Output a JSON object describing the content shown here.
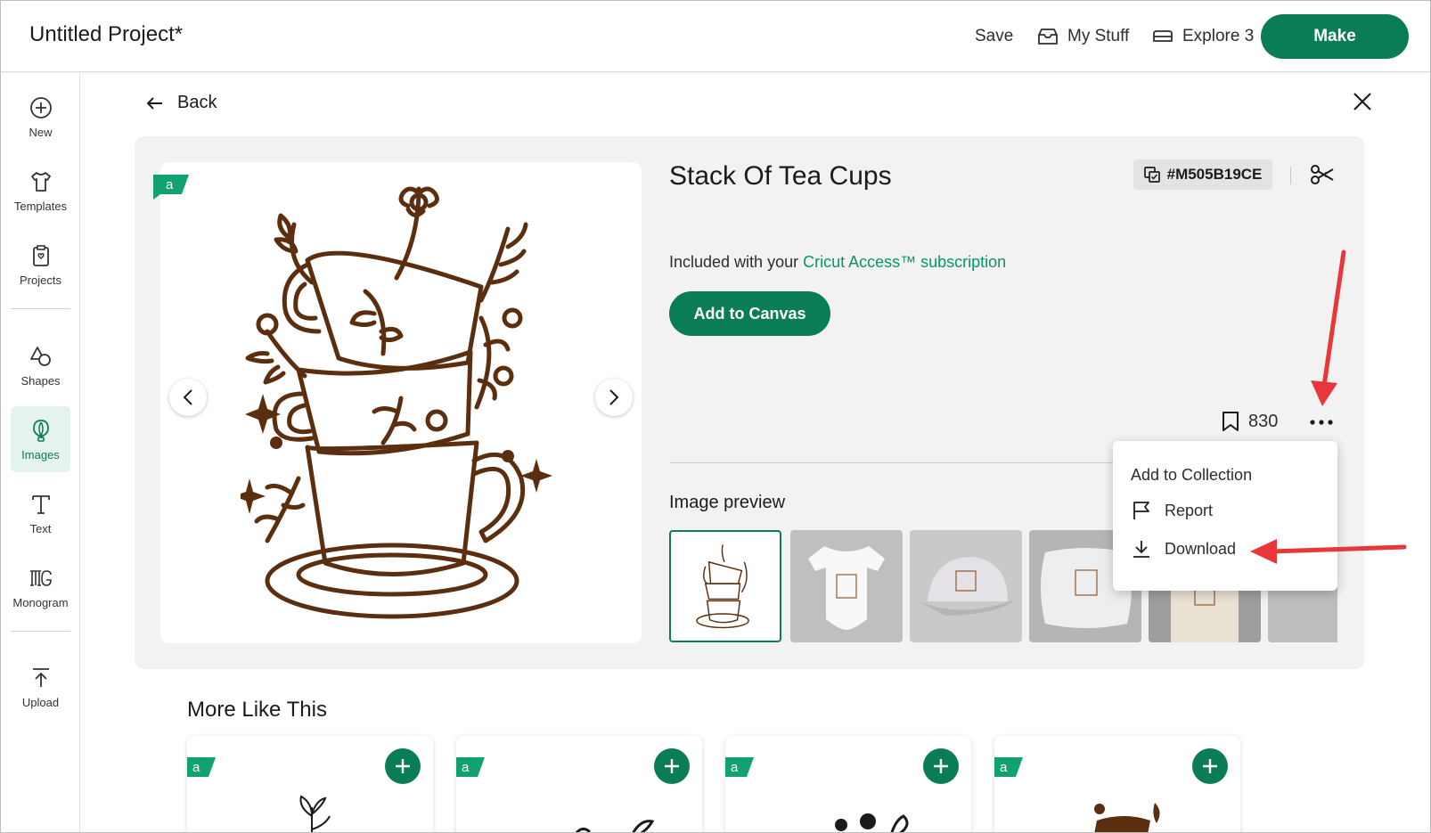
{
  "header": {
    "project_title": "Untitled Project*",
    "save_label": "Save",
    "my_stuff_label": "My Stuff",
    "explore_label": "Explore 3",
    "make_label": "Make"
  },
  "sidebar": {
    "items": [
      {
        "label": "New",
        "icon": "plus-circle-icon"
      },
      {
        "label": "Templates",
        "icon": "shirt-icon"
      },
      {
        "label": "Projects",
        "icon": "clipboard-icon"
      },
      {
        "label": "Shapes",
        "icon": "shapes-icon"
      },
      {
        "label": "Images",
        "icon": "balloon-icon",
        "active": true
      },
      {
        "label": "Text",
        "icon": "text-icon"
      },
      {
        "label": "Monogram",
        "icon": "monogram-icon"
      },
      {
        "label": "Upload",
        "icon": "upload-icon"
      }
    ]
  },
  "detail": {
    "back_label": "Back",
    "title": "Stack Of Tea Cups",
    "image_id": "#M505B19CE",
    "included_text": "Included with your ",
    "included_link": "Cricut Access™ subscription",
    "add_to_canvas_label": "Add to Canvas",
    "save_count": "830",
    "preview_label": "Image preview"
  },
  "menu": {
    "items": [
      "Add to Collection",
      "Report",
      "Download"
    ]
  },
  "more_like_this": {
    "title": "More Like This"
  },
  "colors": {
    "brand_green": "#0a7d55",
    "link_green": "#0a9468",
    "annotation_red": "#e8373a",
    "artwork_brown": "#5a2e0e"
  }
}
